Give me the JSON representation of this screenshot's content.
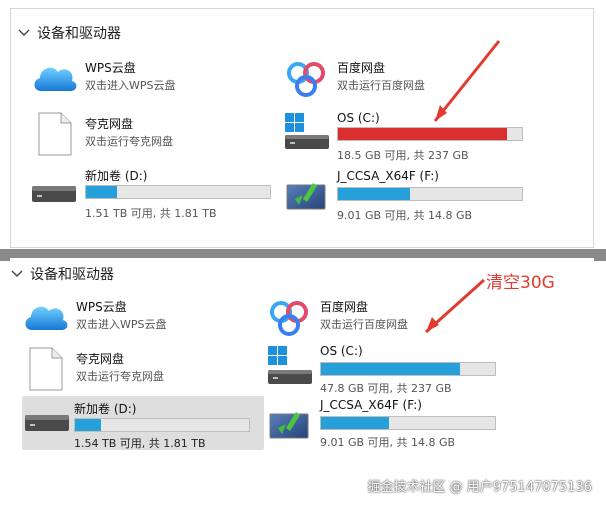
{
  "colors": {
    "usage_normal": "#26a0da",
    "usage_full": "#da2f2f",
    "annotation": "#e23a2f"
  },
  "top": {
    "title": "设备和驱动器",
    "wps": {
      "name": "WPS云盘",
      "desc": "双击进入WPS云盘",
      "icon": "cloud-icon"
    },
    "quark": {
      "name": "夸克网盘",
      "desc": "双击运行夸克网盘",
      "icon": "document-icon"
    },
    "newvol": {
      "name": "新加卷 (D:)",
      "free": "1.51 TB 可用, 共 1.81 TB",
      "usage": 0.17,
      "icon": "drive-icon"
    },
    "baidu": {
      "name": "百度网盘",
      "desc": "双击运行百度网盘",
      "icon": "baidu-netdisk-icon"
    },
    "os": {
      "name": "OS (C:)",
      "free": "18.5 GB 可用, 共 237 GB",
      "usage": 0.92,
      "icon": "windows-drive-icon"
    },
    "ccsa": {
      "name": "J_CCSA_X64F (F:)",
      "free": "9.01 GB 可用, 共 14.8 GB",
      "usage": 0.39,
      "icon": "usb-install-icon"
    }
  },
  "bottom": {
    "title": "设备和驱动器",
    "annotation": "清空30G",
    "wps": {
      "name": "WPS云盘",
      "desc": "双击进入WPS云盘",
      "icon": "cloud-icon"
    },
    "quark": {
      "name": "夸克网盘",
      "desc": "双击运行夸克网盘",
      "icon": "document-icon"
    },
    "newvol": {
      "name": "新加卷 (D:)",
      "free": "1.54 TB 可用, 共 1.81 TB",
      "usage": 0.15,
      "icon": "drive-icon"
    },
    "baidu": {
      "name": "百度网盘",
      "desc": "双击运行百度网盘",
      "icon": "baidu-netdisk-icon"
    },
    "os": {
      "name": "OS (C:)",
      "free": "47.8 GB 可用, 共 237 GB",
      "usage": 0.8,
      "icon": "windows-drive-icon"
    },
    "ccsa": {
      "name": "J_CCSA_X64F (F:)",
      "free": "9.01 GB 可用, 共 14.8 GB",
      "usage": 0.39,
      "icon": "usb-install-icon"
    }
  },
  "watermark": "掘金技术社区 @ 用户975147075136"
}
